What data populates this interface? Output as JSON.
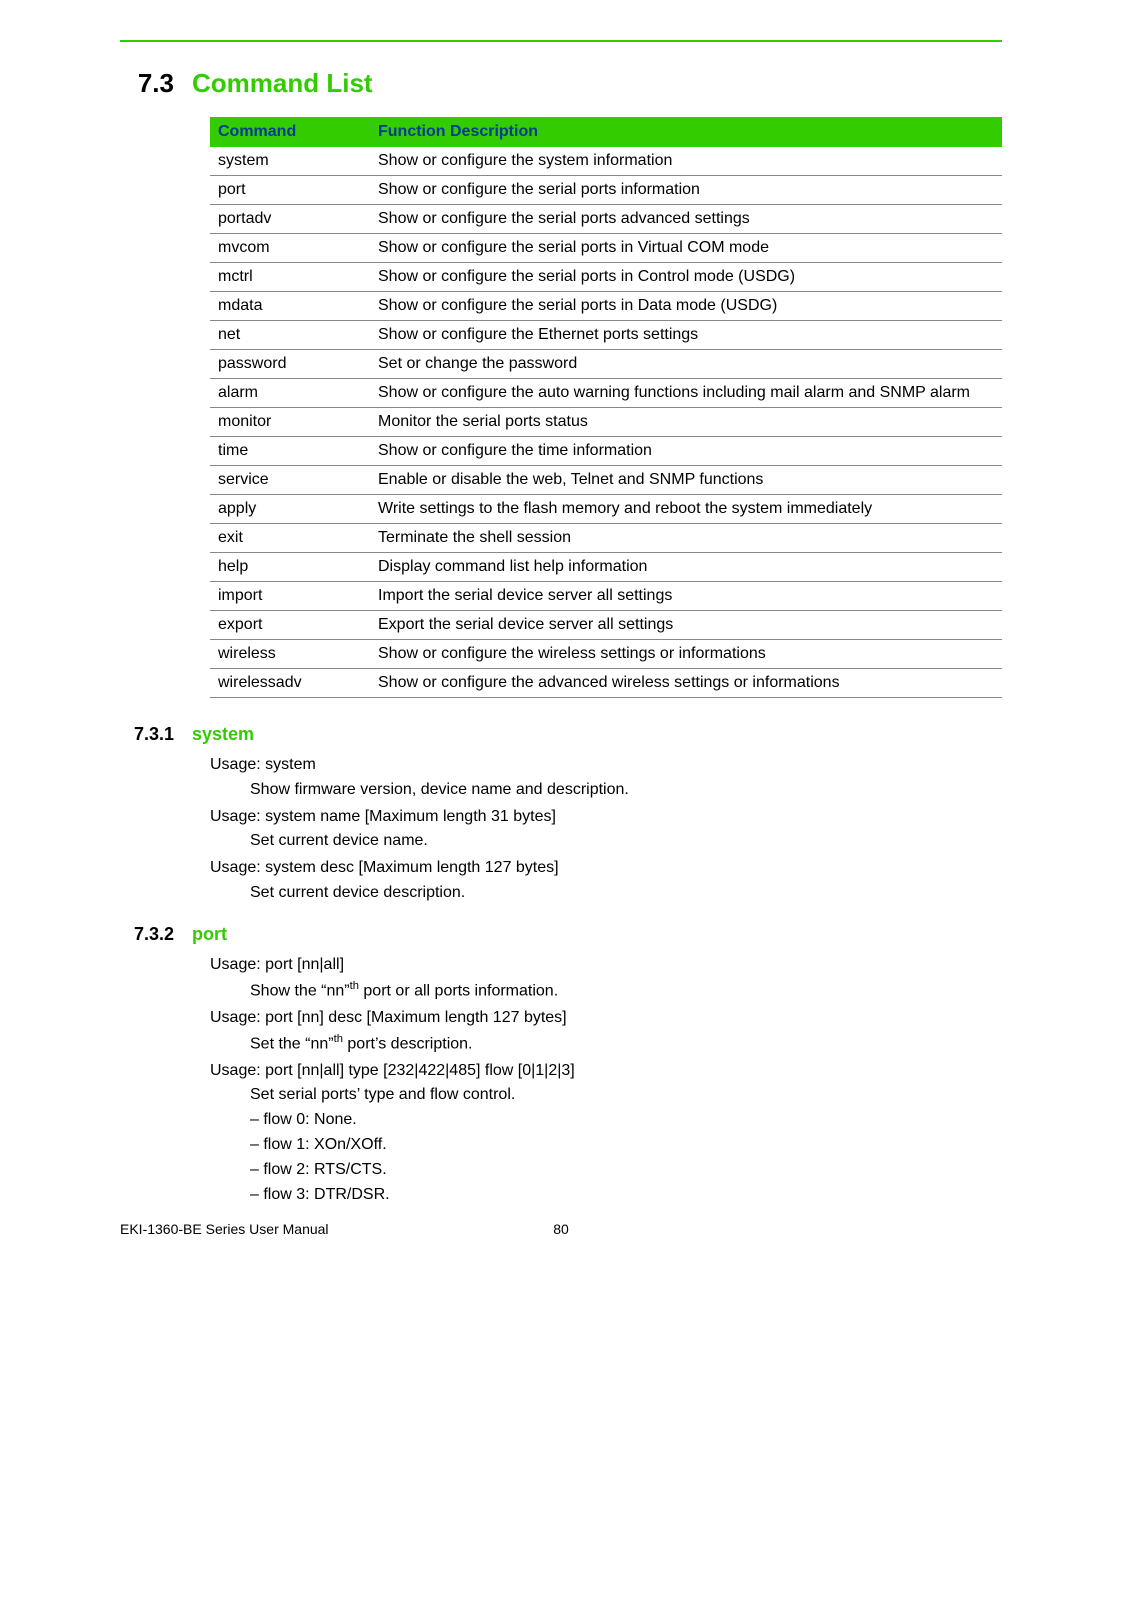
{
  "section": {
    "number": "7.3",
    "title": "Command List"
  },
  "table": {
    "headers": [
      "Command",
      "Function Description"
    ],
    "rows": [
      {
        "cmd": "system",
        "desc": "Show or configure the system information"
      },
      {
        "cmd": "port",
        "desc": "Show or configure the serial ports information"
      },
      {
        "cmd": "portadv",
        "desc": "Show or configure the serial ports advanced settings"
      },
      {
        "cmd": "mvcom",
        "desc": "Show or configure the serial ports in Virtual COM mode"
      },
      {
        "cmd": "mctrl",
        "desc": "Show or configure the serial ports in Control mode (USDG)"
      },
      {
        "cmd": "mdata",
        "desc": "Show or configure the serial ports in Data mode (USDG)"
      },
      {
        "cmd": "net",
        "desc": "Show or configure the Ethernet ports settings"
      },
      {
        "cmd": "password",
        "desc": "Set or change the password"
      },
      {
        "cmd": "alarm",
        "desc": "Show or configure the auto warning functions including mail alarm and SNMP alarm"
      },
      {
        "cmd": "monitor",
        "desc": "Monitor the serial ports status"
      },
      {
        "cmd": "time",
        "desc": "Show or configure the time information"
      },
      {
        "cmd": "service",
        "desc": "Enable or disable the web, Telnet and SNMP functions"
      },
      {
        "cmd": "apply",
        "desc": "Write settings to the flash memory and reboot the system immediately"
      },
      {
        "cmd": "exit",
        "desc": "Terminate the shell session"
      },
      {
        "cmd": "help",
        "desc": "Display command list help information"
      },
      {
        "cmd": "import",
        "desc": "Import the serial device server all settings"
      },
      {
        "cmd": "export",
        "desc": "Export the serial device server all settings"
      },
      {
        "cmd": "wireless",
        "desc": "Show or configure the wireless settings or informations"
      },
      {
        "cmd": "wirelessadv",
        "desc": "Show or configure the advanced wireless settings or informations"
      }
    ]
  },
  "sub1": {
    "number": "7.3.1",
    "title": "system",
    "lines": {
      "u1": "Usage: system",
      "d1": "Show firmware version, device name and description.",
      "u2": "Usage: system name [Maximum length 31 bytes]",
      "d2": "Set current device name.",
      "u3": "Usage: system desc [Maximum length 127 bytes]",
      "d3": "Set current device description."
    }
  },
  "sub2": {
    "number": "7.3.2",
    "title": "port",
    "lines": {
      "u1": "Usage: port [nn|all]",
      "d1a": "Show the “nn”",
      "d1sup": "th",
      "d1b": " port or all ports information.",
      "u2": "Usage: port [nn] desc [Maximum length 127 bytes]",
      "d2a": "Set the “nn”",
      "d2sup": "th",
      "d2b": " port’s description.",
      "u3": "Usage: port [nn|all] type [232|422|485] flow [0|1|2|3]",
      "d3": "Set serial ports’ type and flow control.",
      "f0": "flow 0: None.",
      "f1": "flow 1: XOn/XOff.",
      "f2": "flow 2: RTS/CTS.",
      "f3": "flow 3: DTR/DSR."
    }
  },
  "footer": {
    "manual": "EKI-1360-BE Series User Manual",
    "page": "80"
  }
}
